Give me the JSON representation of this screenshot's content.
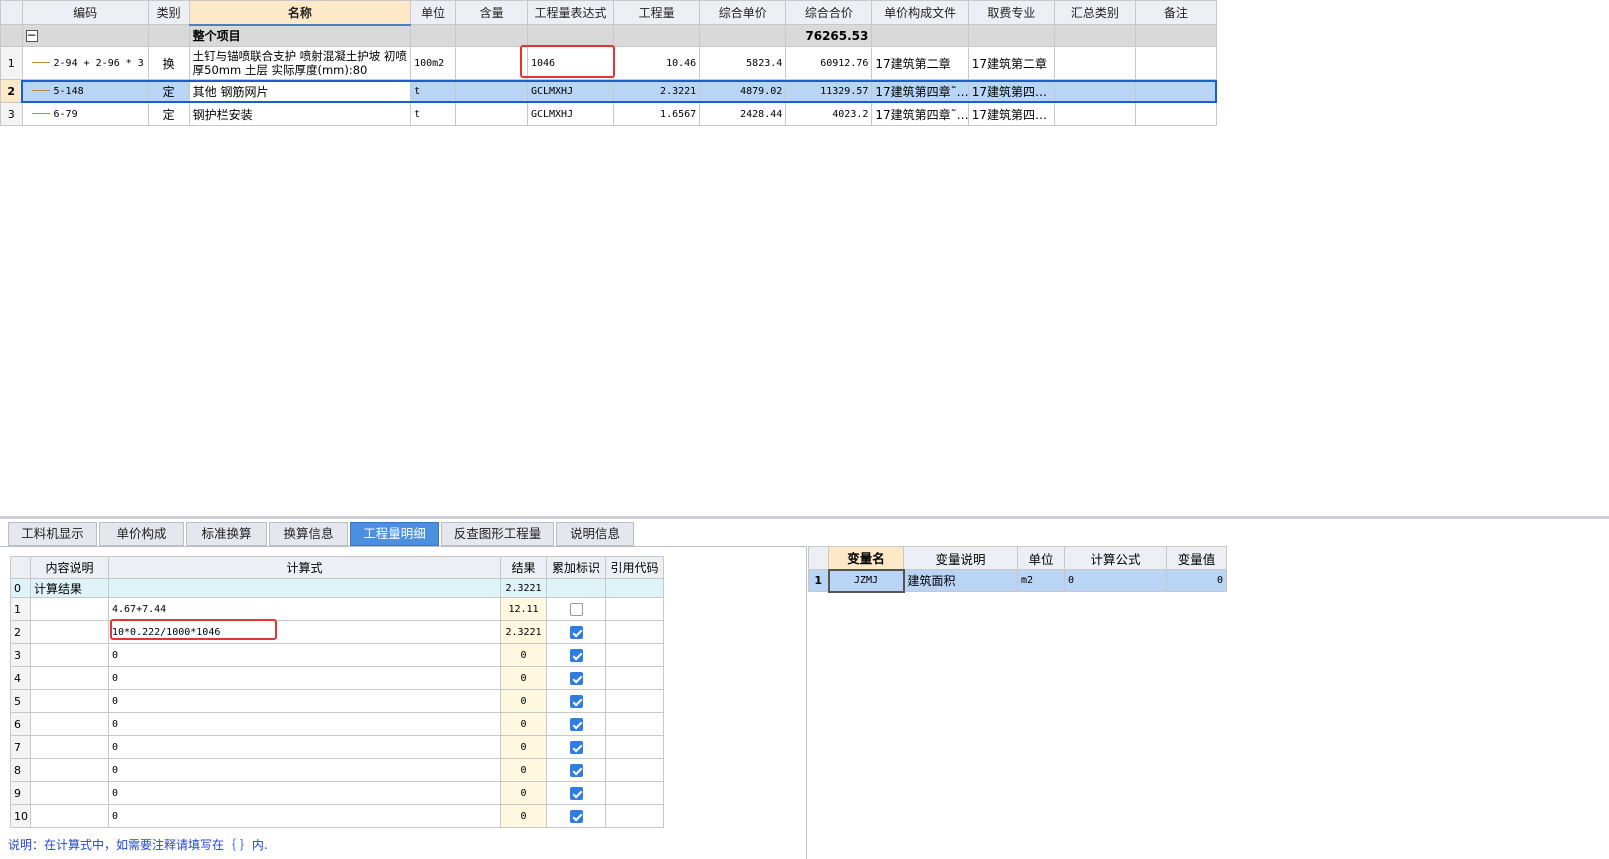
{
  "main_grid": {
    "headers": [
      "编码",
      "类别",
      "名称",
      "单位",
      "含量",
      "工程量表达式",
      "工程量",
      "综合单价",
      "综合合价",
      "单价构成文件",
      "取费专业",
      "汇总类别",
      "备注"
    ],
    "summary": {
      "label": "整个项目",
      "total": "76265.53",
      "collapse_glyph": "−"
    },
    "rows": [
      {
        "num": "1",
        "code": "2-94 + 2-96 * 3",
        "type": "换",
        "name": "土钉与锚喷联合支护 喷射混凝土护坡 初喷厚50mm 土层  实际厚度(mm):80",
        "unit": "100m2",
        "content": "",
        "expr": "1046",
        "qty": "10.46",
        "unit_price": "5823.4",
        "total_price": "60912.76",
        "price_file": "17建筑第二章",
        "fee_major": "17建筑第二章",
        "summary_type": "",
        "remark": ""
      },
      {
        "num": "2",
        "code": "5-148",
        "type": "定",
        "name": "其他 钢筋网片",
        "unit": "t",
        "content": "",
        "expr": "GCLMXHJ",
        "qty": "2.3221",
        "unit_price": "4879.02",
        "total_price": "11329.57",
        "price_file": "17建筑第四章˜…",
        "fee_major": "17建筑第四…",
        "summary_type": "",
        "remark": ""
      },
      {
        "num": "3",
        "code": "6-79",
        "type": "定",
        "name": "钢护栏安装",
        "unit": "t",
        "content": "",
        "expr": "GCLMXHJ",
        "qty": "1.6567",
        "unit_price": "2428.44",
        "total_price": "4023.2",
        "price_file": "17建筑第四章˜…",
        "fee_major": "17建筑第四…",
        "summary_type": "",
        "remark": ""
      }
    ]
  },
  "tabs": [
    "工料机显示",
    "单价构成",
    "标准换算",
    "换算信息",
    "工程量明细",
    "反查图形工程量",
    "说明信息"
  ],
  "active_tab": "工程量明细",
  "detail_grid": {
    "headers": [
      "内容说明",
      "计算式",
      "结果",
      "累加标识",
      "引用代码"
    ],
    "result_row": {
      "num": "0",
      "label": "计算结果",
      "result": "2.3221"
    },
    "rows": [
      {
        "num": "1",
        "desc": "",
        "formula": "4.67+7.44",
        "result": "12.11",
        "accumulate": false,
        "ref": ""
      },
      {
        "num": "2",
        "desc": "",
        "formula": "10*0.222/1000*1046",
        "result": "2.3221",
        "accumulate": true,
        "ref": ""
      },
      {
        "num": "3",
        "desc": "",
        "formula": "0",
        "result": "0",
        "accumulate": true,
        "ref": ""
      },
      {
        "num": "4",
        "desc": "",
        "formula": "0",
        "result": "0",
        "accumulate": true,
        "ref": ""
      },
      {
        "num": "5",
        "desc": "",
        "formula": "0",
        "result": "0",
        "accumulate": true,
        "ref": ""
      },
      {
        "num": "6",
        "desc": "",
        "formula": "0",
        "result": "0",
        "accumulate": true,
        "ref": ""
      },
      {
        "num": "7",
        "desc": "",
        "formula": "0",
        "result": "0",
        "accumulate": true,
        "ref": ""
      },
      {
        "num": "8",
        "desc": "",
        "formula": "0",
        "result": "0",
        "accumulate": true,
        "ref": ""
      },
      {
        "num": "9",
        "desc": "",
        "formula": "0",
        "result": "0",
        "accumulate": true,
        "ref": ""
      },
      {
        "num": "10",
        "desc": "",
        "formula": "0",
        "result": "0",
        "accumulate": true,
        "ref": ""
      }
    ]
  },
  "note": "说明：在计算式中，如需要注释请填写在｛ ｝内.",
  "var_grid": {
    "headers": [
      "变量名",
      "变量说明",
      "单位",
      "计算公式",
      "变量值"
    ],
    "rows": [
      {
        "num": "1",
        "name": "JZMJ",
        "desc": "建筑面积",
        "unit": "m2",
        "formula": "0",
        "value": "0"
      }
    ]
  },
  "colors": {
    "selection": "#b9d4f5",
    "active_tab": "#4b8fe0",
    "highlight": "#e53333",
    "note_text": "#2346d8"
  }
}
